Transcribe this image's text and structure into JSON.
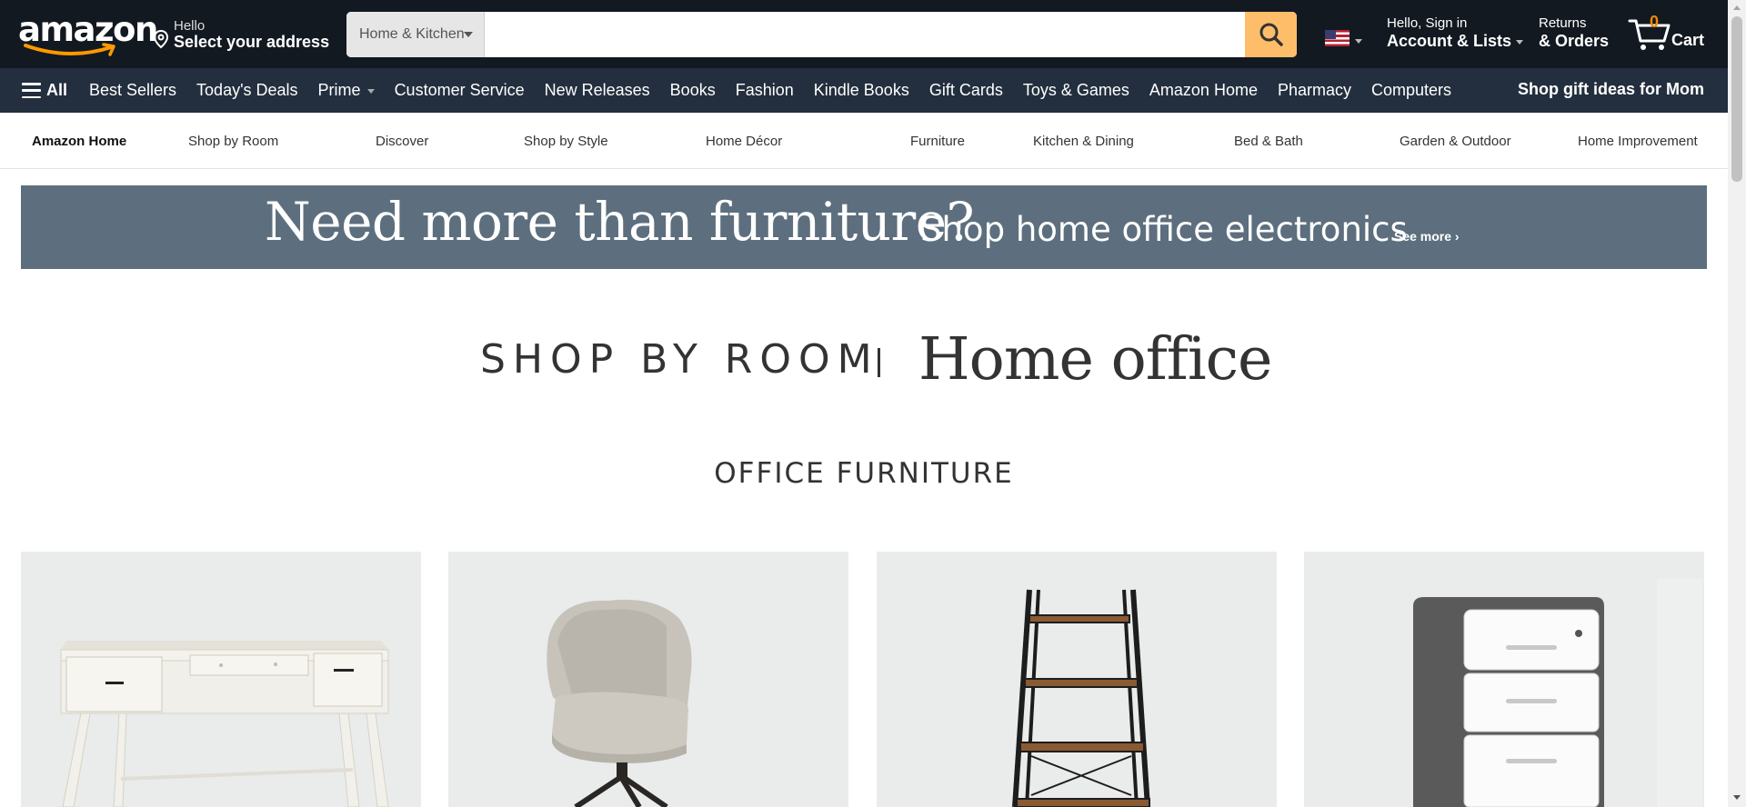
{
  "header": {
    "logo_text": "amazon",
    "location": {
      "greeting": "Hello",
      "action": "Select your address"
    },
    "search": {
      "category": "Home & Kitchen",
      "placeholder": "",
      "value": ""
    },
    "account": {
      "greeting": "Hello, Sign in",
      "label": "Account & Lists"
    },
    "returns": {
      "line1": "Returns",
      "line2": "& Orders"
    },
    "cart": {
      "count": "0",
      "label": "Cart"
    },
    "accent_color": "#febd69",
    "nav_background": "#131921"
  },
  "subnav": {
    "all_label": "All",
    "links": [
      "Best Sellers",
      "Today's Deals",
      "Prime",
      "Customer Service",
      "New Releases",
      "Books",
      "Fashion",
      "Kindle Books",
      "Gift Cards",
      "Toys & Games",
      "Amazon Home",
      "Pharmacy",
      "Computers"
    ],
    "promo": "Shop gift ideas for Mom",
    "background": "#232f3e"
  },
  "store_nav": {
    "items": [
      "Amazon Home",
      "Shop by Room",
      "Discover",
      "Shop by Style",
      "Home Décor",
      "Furniture",
      "Kitchen & Dining",
      "Bed & Bath",
      "Garden & Outdoor",
      "Home Improvement"
    ]
  },
  "banner": {
    "headline": "Need more than furniture?",
    "subheadline": "Shop home office electronics",
    "link": "See more ›",
    "background": "#5d6f7e"
  },
  "page": {
    "shop_by_room": "SHOP BY ROOM",
    "room_name": "Home office",
    "section_title": "OFFICE FURNITURE"
  },
  "products": [
    {
      "icon": "desk-image"
    },
    {
      "icon": "chair-image"
    },
    {
      "icon": "ladder-shelf-image"
    },
    {
      "icon": "file-cabinet-image"
    }
  ]
}
